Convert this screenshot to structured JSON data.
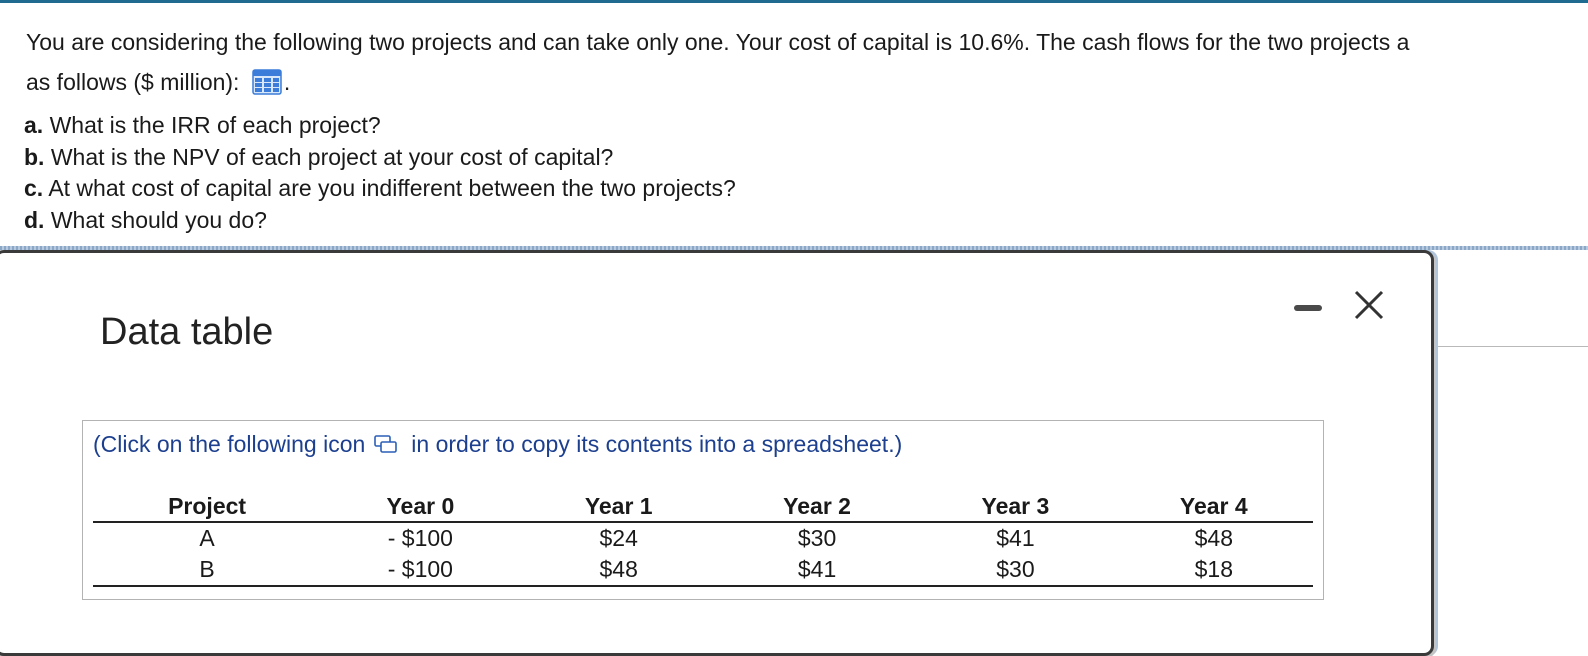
{
  "question": {
    "intro_line1": "You are considering the following two projects and can take only one. Your cost of capital is 10.6%. The cash flows for the two projects a",
    "intro_line2": "as follows ($ million):",
    "intro_tail": ".",
    "parts": [
      {
        "letter": "a.",
        "text": "What is the IRR of each project?"
      },
      {
        "letter": "b.",
        "text": "What is the NPV of each project at your cost of capital?"
      },
      {
        "letter": "c.",
        "text": "At what cost of capital are you indifferent between the two projects?"
      },
      {
        "letter": "d.",
        "text": "What should you do?"
      }
    ]
  },
  "dialog": {
    "title": "Data table",
    "copy_note_before": "(Click on the following icon",
    "copy_note_after": "in order to copy its contents into a spreadsheet.)",
    "icons": {
      "grid": "data-table-grid-icon",
      "copy": "copy-spreadsheet-icon",
      "minimize": "minimize-icon",
      "close": "close-icon"
    },
    "table": {
      "headers": [
        "Project",
        "Year 0",
        "Year 1",
        "Year 2",
        "Year 3",
        "Year 4"
      ],
      "rows": [
        [
          "A",
          "- $100",
          "$24",
          "$30",
          "$41",
          "$48"
        ],
        [
          "B",
          "- $100",
          "$48",
          "$41",
          "$30",
          "$18"
        ]
      ]
    }
  },
  "colors": {
    "accent": "#1f6a8f",
    "link_text": "#1c3f8f",
    "grid_icon": "#3b7dd8"
  }
}
